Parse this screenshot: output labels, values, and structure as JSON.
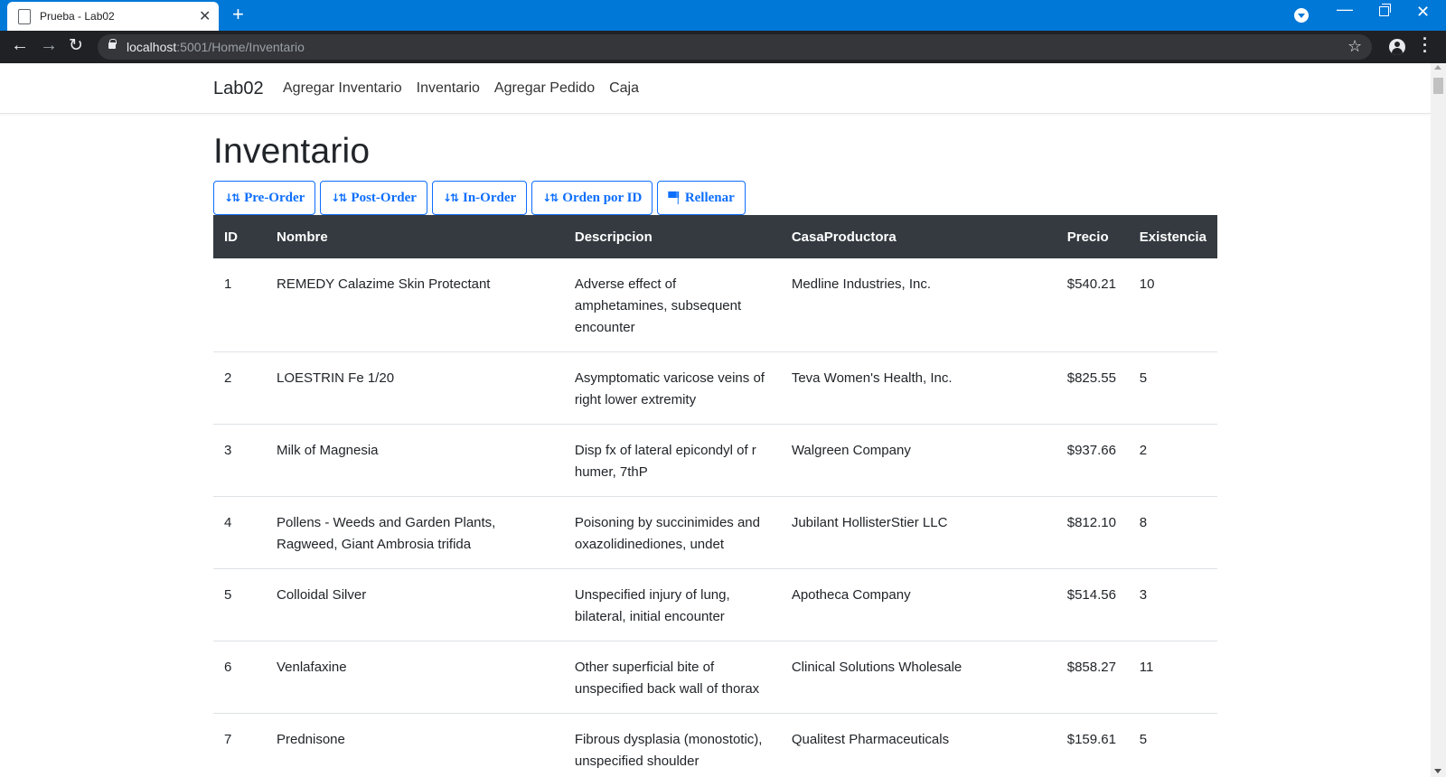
{
  "browser": {
    "tab_title": "Prueba - Lab02",
    "url_host": "localhost",
    "url_rest": ":5001/Home/Inventario"
  },
  "navbar": {
    "brand": "Lab02",
    "links": [
      "Agregar Inventario",
      "Inventario",
      "Agregar Pedido",
      "Caja"
    ]
  },
  "page": {
    "title": "Inventario",
    "buttons": [
      {
        "label": "Pre-Order",
        "icon": "sort-down-icon"
      },
      {
        "label": "Post-Order",
        "icon": "sort-down-icon"
      },
      {
        "label": "In-Order",
        "icon": "sort-down-icon"
      },
      {
        "label": "Orden por ID",
        "icon": "sort-down-icon"
      },
      {
        "label": "Rellenar",
        "icon": "paint-roller-icon"
      }
    ]
  },
  "table": {
    "headers": [
      "ID",
      "Nombre",
      "Descripcion",
      "CasaProductora",
      "Precio",
      "Existencia"
    ],
    "rows": [
      [
        "1",
        "REMEDY Calazime Skin Protectant",
        "Adverse effect of amphetamines, subsequent encounter",
        "Medline Industries, Inc.",
        "$540.21",
        "10"
      ],
      [
        "2",
        "LOESTRIN Fe 1/20",
        "Asymptomatic varicose veins of right lower extremity",
        "Teva Women's Health, Inc.",
        "$825.55",
        "5"
      ],
      [
        "3",
        "Milk of Magnesia",
        "Disp fx of lateral epicondyl of r humer, 7thP",
        "Walgreen Company",
        "$937.66",
        "2"
      ],
      [
        "4",
        "Pollens - Weeds and Garden Plants, Ragweed, Giant Ambrosia trifida",
        "Poisoning by succinimides and oxazolidinediones, undet",
        "Jubilant HollisterStier LLC",
        "$812.10",
        "8"
      ],
      [
        "5",
        "Colloidal Silver",
        "Unspecified injury of lung, bilateral, initial encounter",
        "Apotheca Company",
        "$514.56",
        "3"
      ],
      [
        "6",
        "Venlafaxine",
        "Other superficial bite of unspecified back wall of thorax",
        "Clinical Solutions Wholesale",
        "$858.27",
        "11"
      ],
      [
        "7",
        "Prednisone",
        "Fibrous dysplasia (monostotic), unspecified shoulder",
        "Qualitest Pharmaceuticals",
        "$159.61",
        "5"
      ]
    ]
  }
}
